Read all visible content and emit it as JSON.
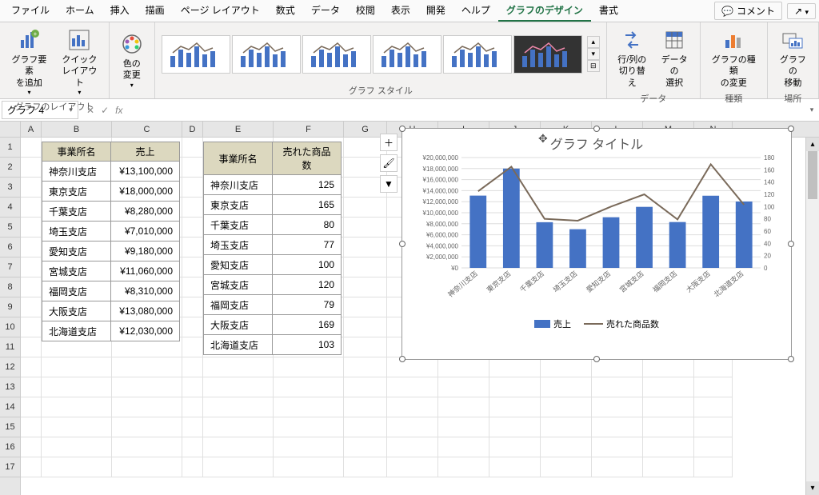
{
  "menu": {
    "items": [
      "ファイル",
      "ホーム",
      "挿入",
      "描画",
      "ページ レイアウト",
      "数式",
      "データ",
      "校閲",
      "表示",
      "開発",
      "ヘルプ",
      "グラフのデザイン",
      "書式"
    ],
    "active_index": 11,
    "comment": "コメント",
    "share": "↗"
  },
  "ribbon": {
    "layout_group": "グラフのレイアウト",
    "add_element": "グラフ要素\nを追加",
    "quick_layout": "クイック\nレイアウト",
    "color_change": "色の\n変更",
    "styles_group": "グラフ スタイル",
    "data_group": "データ",
    "switch_rowcol": "行/列の\n切り替え",
    "select_data": "データの\n選択",
    "type_group": "種類",
    "change_type": "グラフの種類\nの変更",
    "location_group": "場所",
    "move_chart": "グラフの\n移動"
  },
  "formula": {
    "name_box": "グラフ 4",
    "value": ""
  },
  "columns": [
    {
      "l": "A",
      "w": 26
    },
    {
      "l": "B",
      "w": 88
    },
    {
      "l": "C",
      "w": 88
    },
    {
      "l": "D",
      "w": 26
    },
    {
      "l": "E",
      "w": 88
    },
    {
      "l": "F",
      "w": 88
    },
    {
      "l": "G",
      "w": 54
    },
    {
      "l": "H",
      "w": 64
    },
    {
      "l": "I",
      "w": 64
    },
    {
      "l": "J",
      "w": 64
    },
    {
      "l": "K",
      "w": 64
    },
    {
      "l": "L",
      "w": 64
    },
    {
      "l": "M",
      "w": 64
    },
    {
      "l": "N",
      "w": 48
    }
  ],
  "rows": [
    1,
    2,
    3,
    4,
    5,
    6,
    7,
    8,
    9,
    10,
    11,
    12,
    13,
    14,
    15,
    16,
    17
  ],
  "table1": {
    "headers": [
      "事業所名",
      "売上"
    ],
    "rows": [
      [
        "神奈川支店",
        "¥13,100,000"
      ],
      [
        "東京支店",
        "¥18,000,000"
      ],
      [
        "千葉支店",
        "¥8,280,000"
      ],
      [
        "埼玉支店",
        "¥7,010,000"
      ],
      [
        "愛知支店",
        "¥9,180,000"
      ],
      [
        "宮城支店",
        "¥11,060,000"
      ],
      [
        "福岡支店",
        "¥8,310,000"
      ],
      [
        "大阪支店",
        "¥13,080,000"
      ],
      [
        "北海道支店",
        "¥12,030,000"
      ]
    ]
  },
  "table2": {
    "headers": [
      "事業所名",
      "売れた商品数"
    ],
    "rows": [
      [
        "神奈川支店",
        "125"
      ],
      [
        "東京支店",
        "165"
      ],
      [
        "千葉支店",
        "80"
      ],
      [
        "埼玉支店",
        "77"
      ],
      [
        "愛知支店",
        "100"
      ],
      [
        "宮城支店",
        "120"
      ],
      [
        "福岡支店",
        "79"
      ],
      [
        "大阪支店",
        "169"
      ],
      [
        "北海道支店",
        "103"
      ]
    ]
  },
  "chart": {
    "title": "グラフ タイトル",
    "legend1": "売上",
    "legend2": "売れた商品数"
  },
  "chart_data": {
    "type": "combo",
    "title": "グラフ タイトル",
    "categories": [
      "神奈川支店",
      "東京支店",
      "千葉支店",
      "埼玉支店",
      "愛知支店",
      "宮城支店",
      "福岡支店",
      "大阪支店",
      "北海道支店"
    ],
    "series": [
      {
        "name": "売上",
        "type": "bar",
        "axis": "left",
        "values": [
          13100000,
          18000000,
          8280000,
          7010000,
          9180000,
          11060000,
          8310000,
          13080000,
          12030000
        ]
      },
      {
        "name": "売れた商品数",
        "type": "line",
        "axis": "right",
        "values": [
          125,
          165,
          80,
          77,
          100,
          120,
          79,
          169,
          103
        ]
      }
    ],
    "y1_ticks": [
      "¥20,000,000",
      "¥18,000,000",
      "¥16,000,000",
      "¥14,000,000",
      "¥12,000,000",
      "¥10,000,000",
      "¥8,000,000",
      "¥6,000,000",
      "¥4,000,000",
      "¥2,000,000",
      "¥0"
    ],
    "y2_ticks": [
      "180",
      "160",
      "140",
      "120",
      "100",
      "80",
      "60",
      "40",
      "20",
      "0"
    ],
    "y1_range": [
      0,
      20000000
    ],
    "y2_range": [
      0,
      180
    ]
  }
}
